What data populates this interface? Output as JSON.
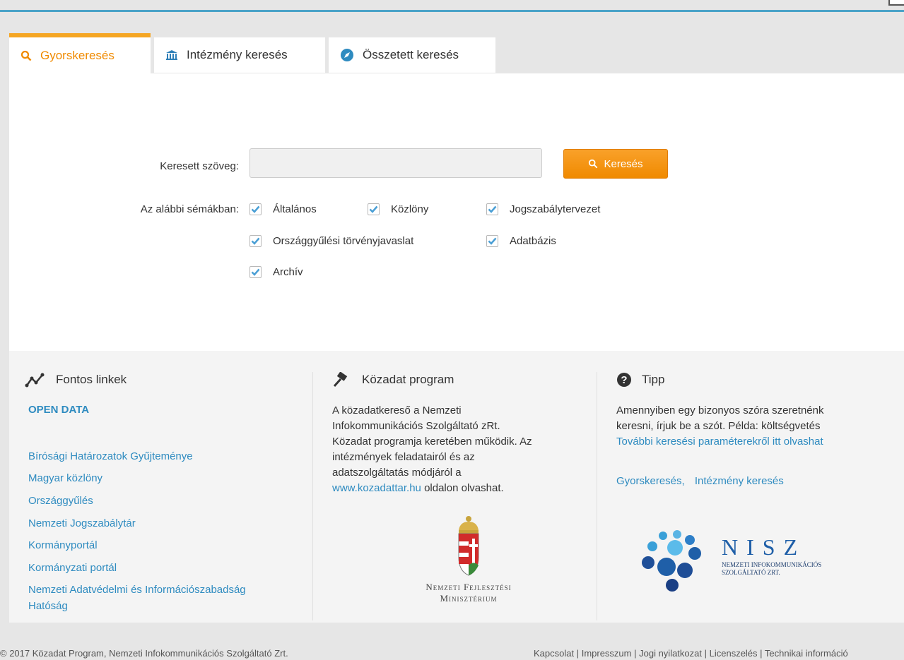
{
  "tabs": [
    {
      "label": "Gyorskeresés",
      "icon": "search-icon",
      "active": true
    },
    {
      "label": "Intézmény keresés",
      "icon": "institution-icon",
      "active": false
    },
    {
      "label": "Összetett keresés",
      "icon": "compass-icon",
      "active": false
    }
  ],
  "search": {
    "label": "Keresett szöveg:",
    "value": "",
    "placeholder": "",
    "button_label": "Keresés"
  },
  "schemas": {
    "label": "Az alábbi sémákban:",
    "options": [
      {
        "label": "Általános",
        "checked": true
      },
      {
        "label": "Közlöny",
        "checked": true
      },
      {
        "label": "Jogszabálytervezet",
        "checked": true
      },
      {
        "label": "Országgyűlési törvényjavaslat",
        "checked": true
      },
      {
        "label": "Adatbázis",
        "checked": true
      },
      {
        "label": "Archív",
        "checked": true
      }
    ]
  },
  "footer": {
    "links_col": {
      "title": "Fontos linkek",
      "open_data": "OPEN DATA",
      "links": [
        "Bírósági Határozatok Gyűjteménye",
        "Magyar közlöny",
        "Országgyűlés",
        "Nemzeti Jogszabálytár",
        "Kormányportál",
        "Kormányzati portál",
        "Nemzeti Adatvédelmi és Információszabadság",
        "Hatóság"
      ]
    },
    "program_col": {
      "title": "Közadat program",
      "lines": [
        "A közadatkereső a Nemzeti",
        "Infokommunikációs Szolgáltató zRt.",
        "Közadat programja keretében működik. Az",
        "intézmények feladatairól és az",
        "adatszolgáltatás módjáról a"
      ],
      "link": "www.kozadattar.hu",
      "link_suffix": " oldalon olvashat.",
      "logo_line1": "Nemzeti Fejlesztési",
      "logo_line2": "Minisztérium"
    },
    "tip_col": {
      "title": "Tipp",
      "line1": "Amennyiben egy bizonyos szóra szeretnénk",
      "line2": "keresni, írjuk be a szót. Példa: költségvetés",
      "more_link": "További keresési paraméterekről itt olvashat",
      "link_a": "Gyorskeresés",
      "link_sep": ",",
      "link_b": "Intézmény keresés",
      "nisz_title": "N I S Z",
      "nisz_sub1": "Nemzeti Infokommunikációs",
      "nisz_sub2": "Szolgáltató Zrt."
    }
  },
  "bottom": {
    "copyright": "© 2017 Közadat Program, Nemzeti Infokommunikációs Szolgáltató Zrt.",
    "links": [
      "Kapcsolat",
      "Impresszum",
      "Jogi nyilatkozat",
      "Licenszelés",
      "Technikai információ"
    ],
    "separator": " | "
  },
  "colors": {
    "accent": "#f08a00",
    "link": "#2e8bc0",
    "topbar": "#4aa3c8",
    "checkbox": "#4a9fd5"
  }
}
